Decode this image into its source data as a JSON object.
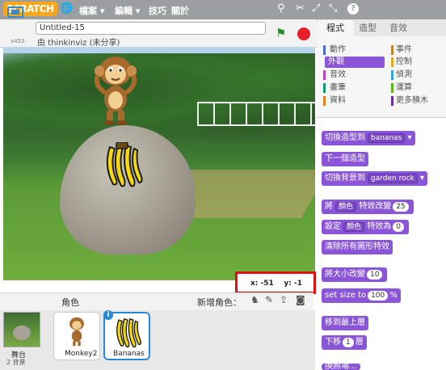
{
  "topbar": {
    "logo": "SCRATCH",
    "menus": [
      "檔案",
      "編輯",
      "技巧",
      "關於"
    ],
    "tools": [
      "duplicate-icon",
      "cut-icon",
      "grow-icon",
      "shrink-icon",
      "help-icon"
    ],
    "help_label": "?"
  },
  "stage_header": {
    "version": "v453",
    "project_title": "Untitled-15",
    "byline": "由 thinkinviz (未分享)"
  },
  "coords": {
    "x_label": "x:",
    "x": "-51",
    "y_label": "y:",
    "y": "-1"
  },
  "sprite_pane": {
    "title": "角色",
    "new_sprite": "新增角色：",
    "stage_label": "舞台",
    "backdrop_count": "2 背景",
    "sprites": [
      {
        "name": "Monkey2"
      },
      {
        "name": "Bananas",
        "selected": true
      }
    ]
  },
  "right_panel": {
    "tabs": [
      "程式",
      "造型",
      "音效"
    ],
    "categories": [
      {
        "label": "動作",
        "color": "#4a6cd4"
      },
      {
        "label": "事件",
        "color": "#c88330"
      },
      {
        "label": "外觀",
        "color": "#8a55d7",
        "selected": true
      },
      {
        "label": "控制",
        "color": "#e1a91a"
      },
      {
        "label": "音效",
        "color": "#bb42c3"
      },
      {
        "label": "偵測",
        "color": "#2ca5e2"
      },
      {
        "label": "畫筆",
        "color": "#0e9a6c"
      },
      {
        "label": "運算",
        "color": "#5cb712"
      },
      {
        "label": "資料",
        "color": "#ee7d16"
      },
      {
        "label": "更多積木",
        "color": "#632d99"
      }
    ],
    "blocks": {
      "switch_costume": "切換造型到",
      "costume_value": "bananas",
      "next_costume": "下一個造型",
      "switch_backdrop": "切換背景到",
      "backdrop_value": "garden rock",
      "change_effect_a": "將",
      "effect_value": "顏色",
      "change_effect_b": "特效改變",
      "change_effect_num": "25",
      "set_effect_a": "設定",
      "set_effect_value": "顏色",
      "set_effect_b": "特效為",
      "set_effect_num": "0",
      "clear_effects": "清除所有圖形特效",
      "change_size": "將大小改變",
      "change_size_num": "10",
      "set_size": "set size to",
      "set_size_num": "100",
      "set_size_unit": "%",
      "front": "移到最上層",
      "back_a": "下移",
      "back_num": "1",
      "back_b": "層",
      "next_partial": "換照場..."
    }
  }
}
